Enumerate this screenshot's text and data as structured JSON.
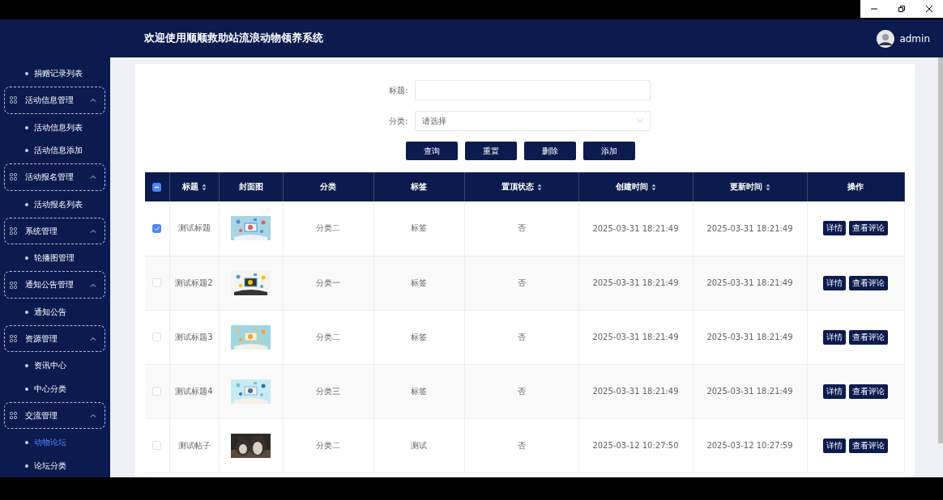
{
  "sidebar": {
    "items": [
      {
        "kind": "sub",
        "label": "捐赠记录列表",
        "selected": false
      },
      {
        "kind": "group",
        "label": "活动信息管理",
        "expanded": true
      },
      {
        "kind": "sub",
        "label": "活动信息列表",
        "selected": false
      },
      {
        "kind": "sub",
        "label": "活动信息添加",
        "selected": false
      },
      {
        "kind": "group",
        "label": "活动报名管理",
        "expanded": true
      },
      {
        "kind": "sub",
        "label": "活动报名列表",
        "selected": false
      },
      {
        "kind": "group",
        "label": "系统管理",
        "expanded": true
      },
      {
        "kind": "sub",
        "label": "轮播图管理",
        "selected": false
      },
      {
        "kind": "group",
        "label": "通知公告管理",
        "expanded": true
      },
      {
        "kind": "sub",
        "label": "通知公告",
        "selected": false
      },
      {
        "kind": "group",
        "label": "资源管理",
        "expanded": true
      },
      {
        "kind": "sub",
        "label": "资讯中心",
        "selected": false
      },
      {
        "kind": "sub",
        "label": "中心分类",
        "selected": false
      },
      {
        "kind": "group",
        "label": "交流管理",
        "expanded": true
      },
      {
        "kind": "sub",
        "label": "动物论坛",
        "selected": true
      },
      {
        "kind": "sub",
        "label": "论坛分类",
        "selected": false
      }
    ]
  },
  "header": {
    "title": "欢迎使用顺顺救助站流浪动物领养系统",
    "user": "admin"
  },
  "search": {
    "fields": [
      {
        "kind": "input",
        "label": "标题:"
      },
      {
        "kind": "select",
        "label": "分类:",
        "placeholder": "请选择"
      }
    ],
    "buttons": [
      "查询",
      "重置",
      "删除",
      "添加"
    ]
  },
  "table": {
    "select_all": {
      "checked": false,
      "indeterminate": true
    },
    "columns": [
      {
        "label": "标题",
        "sortable": true
      },
      {
        "label": "封面图",
        "sortable": false
      },
      {
        "label": "分类",
        "sortable": false
      },
      {
        "label": "标签",
        "sortable": false
      },
      {
        "label": "置顶状态",
        "sortable": true
      },
      {
        "label": "创建时间",
        "sortable": true
      },
      {
        "label": "更新时间",
        "sortable": true
      },
      {
        "label": "操作",
        "sortable": false
      }
    ],
    "rows": [
      {
        "checked": true,
        "title": "测试标题",
        "category": "分类二",
        "tag": "标签",
        "pinned": "否",
        "created": "2025-03-31 18:21:49",
        "updated": "2025-03-31 18:21:49",
        "actions": [
          "详情",
          "查看评论"
        ]
      },
      {
        "checked": false,
        "title": "测试标题2",
        "category": "分类一",
        "tag": "标签",
        "pinned": "否",
        "created": "2025-03-31 18:21:49",
        "updated": "2025-03-31 18:21:49",
        "actions": [
          "详情",
          "查看评论"
        ]
      },
      {
        "checked": false,
        "title": "测试标题3",
        "category": "分类二",
        "tag": "标签",
        "pinned": "否",
        "created": "2025-03-31 18:21:49",
        "updated": "2025-03-31 18:21:49",
        "actions": [
          "详情",
          "查看评论"
        ]
      },
      {
        "checked": false,
        "title": "测试标题4",
        "category": "分类三",
        "tag": "标签",
        "pinned": "否",
        "created": "2025-03-31 18:21:49",
        "updated": "2025-03-31 18:21:49",
        "actions": [
          "详情",
          "查看评论"
        ]
      },
      {
        "checked": false,
        "title": "测试帖子",
        "category": "分类二",
        "tag": "测试",
        "pinned": "否",
        "created": "2025-03-12 10:27:50",
        "updated": "2025-03-12 10:27:59",
        "actions": [
          "详情",
          "查看评论"
        ]
      }
    ]
  }
}
